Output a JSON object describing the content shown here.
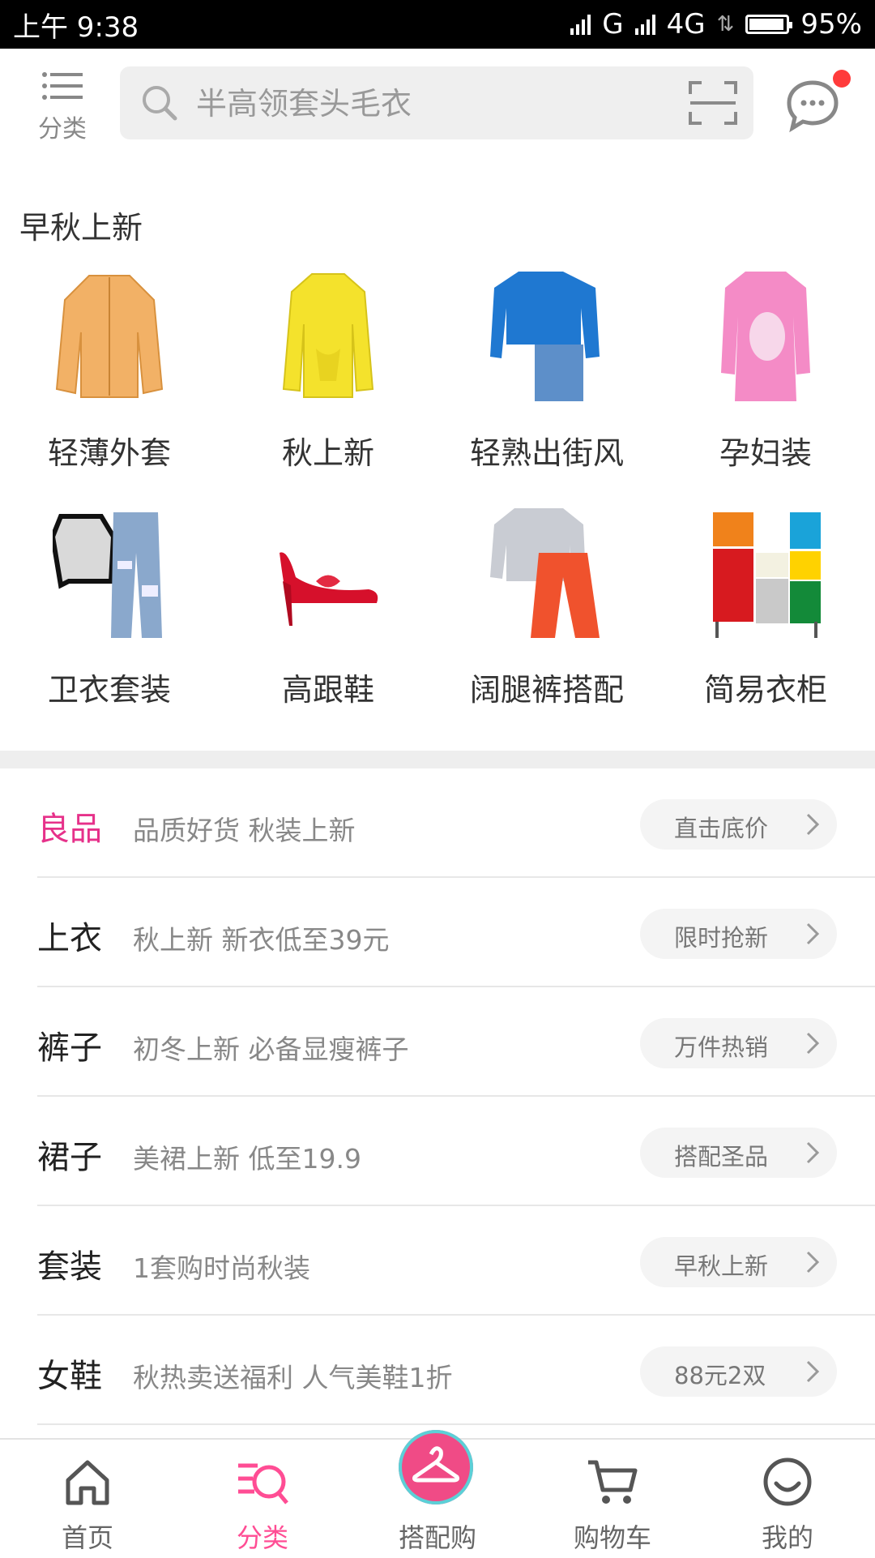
{
  "status_bar": {
    "time": "上午 9:38",
    "network_1": "G",
    "network_2": "4G",
    "battery": "95%",
    "battery_level": 0.95
  },
  "header": {
    "category_label": "分类",
    "search_placeholder": "半高领套头毛衣",
    "unread_dot_color": "#ff3b3b"
  },
  "section": {
    "title": "早秋上新",
    "items": [
      {
        "name": "轻薄外套",
        "icon": "orange-bomber-jacket"
      },
      {
        "name": "秋上新",
        "icon": "yellow-cardigan"
      },
      {
        "name": "轻熟出街风",
        "icon": "blue-sweater-denim-skirt"
      },
      {
        "name": "孕妇装",
        "icon": "pink-sweater-dress"
      },
      {
        "name": "卫衣套装",
        "icon": "sweatshirt-ripped-jeans"
      },
      {
        "name": "高跟鞋",
        "icon": "red-high-heel"
      },
      {
        "name": "阔腿裤搭配",
        "icon": "grey-sweatshirt-red-wide-pants"
      },
      {
        "name": "简易衣柜",
        "icon": "colorful-cabinet"
      }
    ]
  },
  "list": [
    {
      "category": "良品",
      "highlight": true,
      "desc": "品质好货 秋装上新",
      "tag": "直击底价"
    },
    {
      "category": "上衣",
      "highlight": false,
      "desc": "秋上新 新衣低至39元",
      "tag": "限时抢新"
    },
    {
      "category": "裤子",
      "highlight": false,
      "desc": "初冬上新 必备显瘦裤子",
      "tag": "万件热销"
    },
    {
      "category": "裙子",
      "highlight": false,
      "desc": "美裙上新 低至19.9",
      "tag": "搭配圣品"
    },
    {
      "category": "套装",
      "highlight": false,
      "desc": "1套购时尚秋装",
      "tag": "早秋上新"
    },
    {
      "category": "女鞋",
      "highlight": false,
      "desc": "秋热卖送福利 人气美鞋1折",
      "tag": "88元2双"
    }
  ],
  "bottom_nav": {
    "items": [
      {
        "label": "首页",
        "icon": "home-icon"
      },
      {
        "label": "分类",
        "icon": "category-search-icon",
        "active": true
      },
      {
        "label": "搭配购",
        "icon": "hanger-icon"
      },
      {
        "label": "购物车",
        "icon": "cart-icon"
      },
      {
        "label": "我的",
        "icon": "profile-face-icon"
      }
    ],
    "active_color": "#ff4d94"
  },
  "colors": {
    "accent_pink": "#e6318a",
    "nav_active": "#ff4d94"
  }
}
